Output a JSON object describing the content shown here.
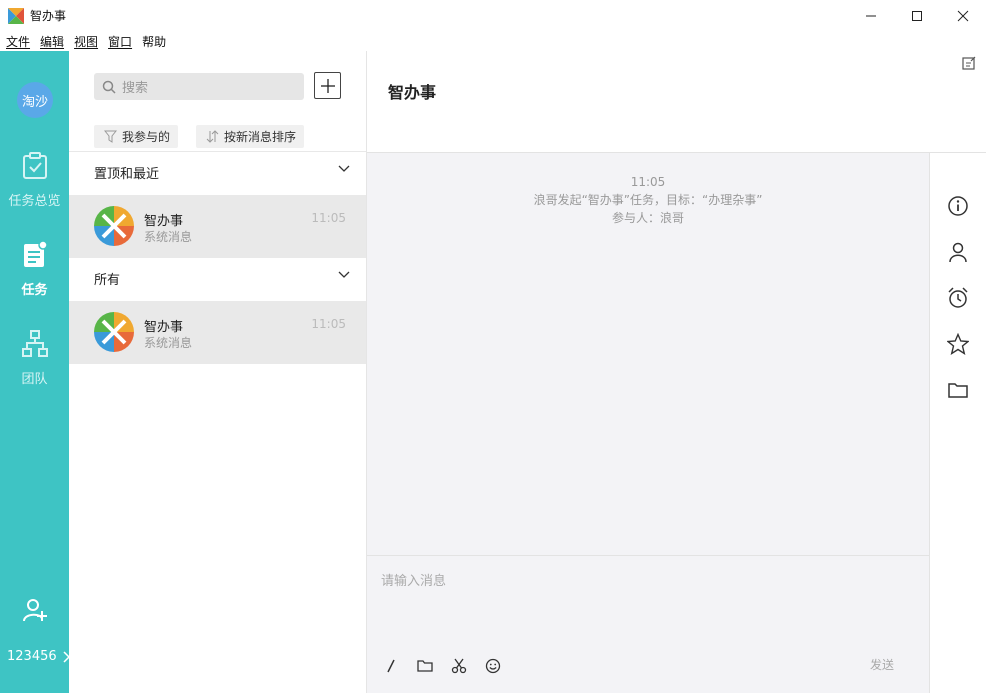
{
  "window": {
    "title": "智办事",
    "controls": {
      "minimize": "—",
      "maximize": "☐",
      "close": "✕"
    }
  },
  "menu": [
    "文件",
    "编辑",
    "视图",
    "窗口",
    "帮助"
  ],
  "rail": {
    "avatar_text": "淘沙",
    "items": [
      {
        "label": "任务总览",
        "icon": "clipboard-check-icon",
        "active": false
      },
      {
        "label": "任务",
        "icon": "task-list-icon",
        "active": true
      },
      {
        "label": "团队",
        "icon": "org-chart-icon",
        "active": false
      }
    ],
    "user_id": "123456",
    "add_member_icon": "add-user-icon"
  },
  "list": {
    "search_placeholder": "搜索",
    "filters": [
      "我参与的",
      "按新消息排序"
    ],
    "sections": [
      {
        "title": "置顶和最近",
        "items": [
          {
            "name": "智办事",
            "sub": "系统消息",
            "time": "11:05"
          }
        ]
      },
      {
        "title": "所有",
        "items": [
          {
            "name": "智办事",
            "sub": "系统消息",
            "time": "11:05"
          }
        ]
      }
    ]
  },
  "chat": {
    "title": "智办事",
    "messages": [
      "11:05",
      "浪哥发起“智办事”任务，目标：“办理杂事”",
      "参与人：浪哥"
    ],
    "input_placeholder": "请输入消息",
    "send_label": "发送"
  },
  "colors": {
    "rail": "#3ec4c4",
    "avatar": "#5aa8e8",
    "selected_row": "#e9e9e9",
    "chat_bg": "#f3f3f6"
  }
}
